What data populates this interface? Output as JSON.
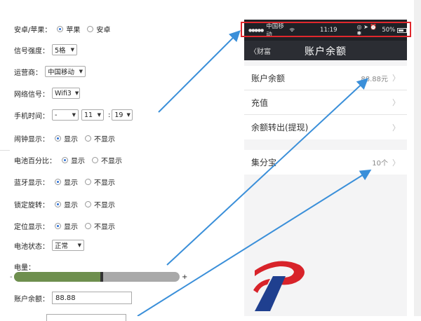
{
  "form": {
    "platform": {
      "label": "安卓/苹果：",
      "options": [
        "苹果",
        "安卓"
      ],
      "selected": 0
    },
    "signal": {
      "label": "信号强度：",
      "value": "5格"
    },
    "carrier": {
      "label": "运营商：",
      "value": "中国移动"
    },
    "network": {
      "label": "网络信号：",
      "value": "Wifi3"
    },
    "time": {
      "label": "手机时间：",
      "hour": "-",
      "min": "11",
      "sec": "19",
      "separator": ":"
    },
    "alarm": {
      "label": "闹钟显示：",
      "on": "显示",
      "off": "不显示"
    },
    "battery_pct": {
      "label": "电池百分比：",
      "on": "显示",
      "off": "不显示"
    },
    "bluetooth": {
      "label": "蓝牙显示：",
      "on": "显示",
      "off": "不显示"
    },
    "rotation": {
      "label": "锁定旋转：",
      "on": "显示",
      "off": "不显示"
    },
    "location": {
      "label": "定位显示：",
      "on": "显示",
      "off": "不显示"
    },
    "battery_state": {
      "label": "电池状态：",
      "value": "正常"
    },
    "charge": {
      "label": "电量：",
      "level_percent": 53,
      "minus": "-",
      "plus": "+"
    },
    "balance": {
      "label": "账户余额：",
      "value": "88.88"
    }
  },
  "phone": {
    "status": {
      "dots": "●●●●●",
      "carrier": "中国移动",
      "wifi": "wifi-icon",
      "time": "11:19",
      "icons": "◎ ➤ ⏰ ✱",
      "battery": "50%"
    },
    "nav": {
      "back_label": "财富",
      "title": "账户余额"
    },
    "items": [
      {
        "label": "账户余额",
        "value": "88.88元"
      },
      {
        "label": "充值",
        "value": ""
      },
      {
        "label": "余额转出(提现)",
        "value": ""
      }
    ],
    "items2": [
      {
        "label": "集分宝",
        "value": "10个"
      }
    ]
  },
  "colors": {
    "arrow": "#3a8fd9",
    "highlight": "#e0282d",
    "navbar": "#2b2d33",
    "slider_fill": "#6e8f4e"
  }
}
